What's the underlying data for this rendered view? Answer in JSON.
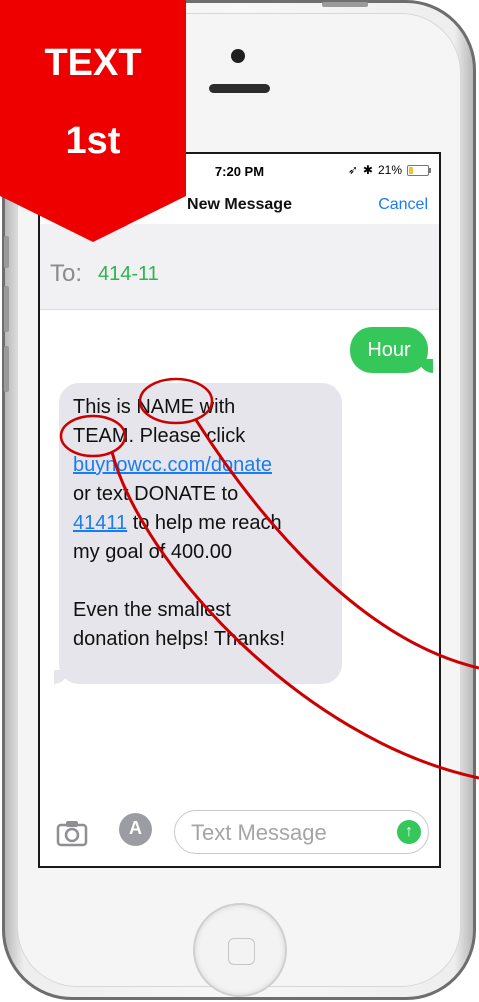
{
  "badge": {
    "line1": "TEXT",
    "line2": "1st",
    "color": "#ee0000"
  },
  "status_bar": {
    "time": "7:20 PM",
    "icons": [
      "location-arrow-icon",
      "bluetooth-icon"
    ],
    "battery": "21%",
    "battery_level": 0.21
  },
  "nav": {
    "title": "New Message",
    "cancel": "Cancel"
  },
  "recipient": {
    "label": "To:",
    "value": "414-11"
  },
  "messages": {
    "outgoing": "Hour",
    "incoming_lines": [
      {
        "parts": [
          {
            "text": "This is NAME with",
            "link": false
          }
        ]
      },
      {
        "parts": [
          {
            "text": "TEAM. Please click",
            "link": false
          }
        ]
      },
      {
        "parts": [
          {
            "text": "buynowcc.com/donate",
            "link": true
          }
        ]
      },
      {
        "parts": [
          {
            "text": "or text DONATE to",
            "link": false
          }
        ]
      },
      {
        "parts": [
          {
            "text": "41411",
            "link": true
          },
          {
            "text": " to help me reach",
            "link": false
          }
        ]
      },
      {
        "parts": [
          {
            "text": "my goal of 400.00",
            "link": false
          }
        ]
      },
      {
        "parts": [
          {
            "text": "",
            "link": false
          }
        ]
      },
      {
        "parts": [
          {
            "text": "Even the smallest",
            "link": false
          }
        ]
      },
      {
        "parts": [
          {
            "text": "donation helps! Thanks!",
            "link": false
          }
        ]
      }
    ]
  },
  "composer": {
    "placeholder": "Text Message",
    "icons": [
      "camera-icon",
      "app-store-icon",
      "send-arrow-icon"
    ]
  },
  "colors": {
    "imessage_blue": "#1a7cf5",
    "sms_green": "#35c759",
    "bubble_gray": "#e6e5eb",
    "annotation_red": "#cc0000"
  }
}
